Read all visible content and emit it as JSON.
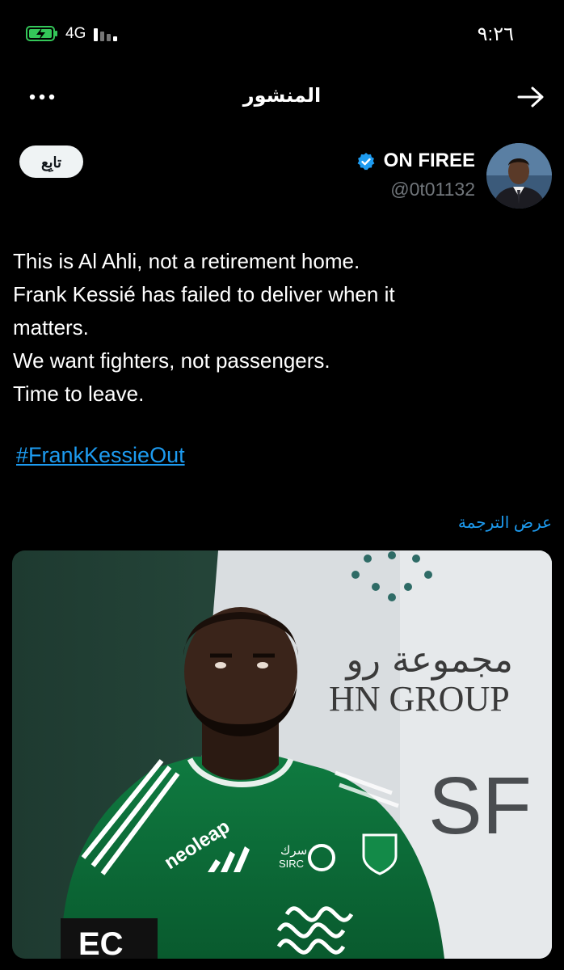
{
  "status_bar": {
    "time": "٩:٢٦",
    "network": "4G",
    "icons": [
      "battery-charging-icon",
      "signal-bars-icon"
    ]
  },
  "header": {
    "title": "المنشور",
    "icons": [
      "more-options-icon",
      "forward-arrow-icon"
    ]
  },
  "author": {
    "name": "ON FIREE",
    "handle": "@0t01132",
    "verified": true,
    "follow_label": "تابِع"
  },
  "tweet": {
    "lines": [
      "This is Al Ahli, not a retirement home.",
      "Frank Kessié has failed to deliver when it",
      "matters.",
      "We want fighters, not passengers.",
      "Time to leave."
    ],
    "hashtag": "#FrankKessieOut",
    "translate_label": "عرض الترجمة"
  },
  "media": {
    "banner_arabic": "مجموعة رو",
    "banner_english": "HN GROUP",
    "banner_letters": "SF",
    "shirt_sponsor": "neoleap",
    "shirt_partner": "SIRC",
    "shirt_partner_arabic": "سرك",
    "armband_text": "EC"
  },
  "colors": {
    "background": "#000000",
    "text": "#ffffff",
    "muted": "#71767b",
    "link": "#1d9bf0",
    "verified": "#1d9bf0",
    "jersey": "#0d6e3a"
  }
}
